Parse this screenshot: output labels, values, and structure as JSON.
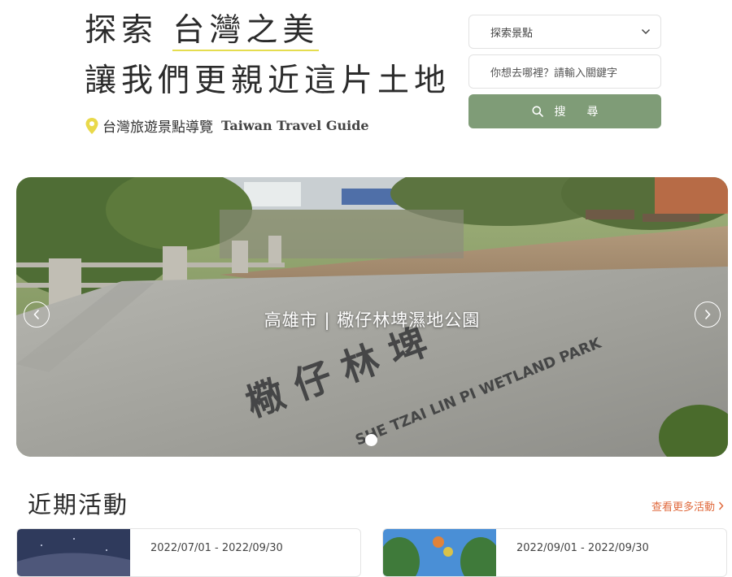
{
  "hero": {
    "title_prefix": "探索",
    "title_highlight": "台灣之美",
    "title_line2": "讓我們更親近這片土地",
    "subtitle_cn": "台灣旅遊景點導覽",
    "subtitle_en": "Taiwan Travel Guide"
  },
  "search": {
    "select_value": "探索景點",
    "input_placeholder": "你想去哪裡？請輸入關鍵字",
    "button_label": "搜尋"
  },
  "banner": {
    "caption": "高雄市 | 㯳仔林埤濕地公園",
    "slide_count": 1,
    "active_slide": 1
  },
  "events": {
    "section_title": "近期活動",
    "more_label": "查看更多活動",
    "cards": [
      {
        "date": "2022/07/01 - 2022/09/30"
      },
      {
        "date": "2022/09/01 - 2022/09/30"
      }
    ]
  },
  "colors": {
    "accent_green": "#7f9c77",
    "highlight_yellow": "#e5dd4f",
    "link_orange": "#e06a3d",
    "pin_yellow": "#e9d94a"
  },
  "icons": {
    "location": "map-pin-icon",
    "dropdown": "chevron-down-icon",
    "search": "search-icon",
    "prev": "chevron-left-icon",
    "next": "chevron-right-icon",
    "more": "chevron-right-icon"
  }
}
